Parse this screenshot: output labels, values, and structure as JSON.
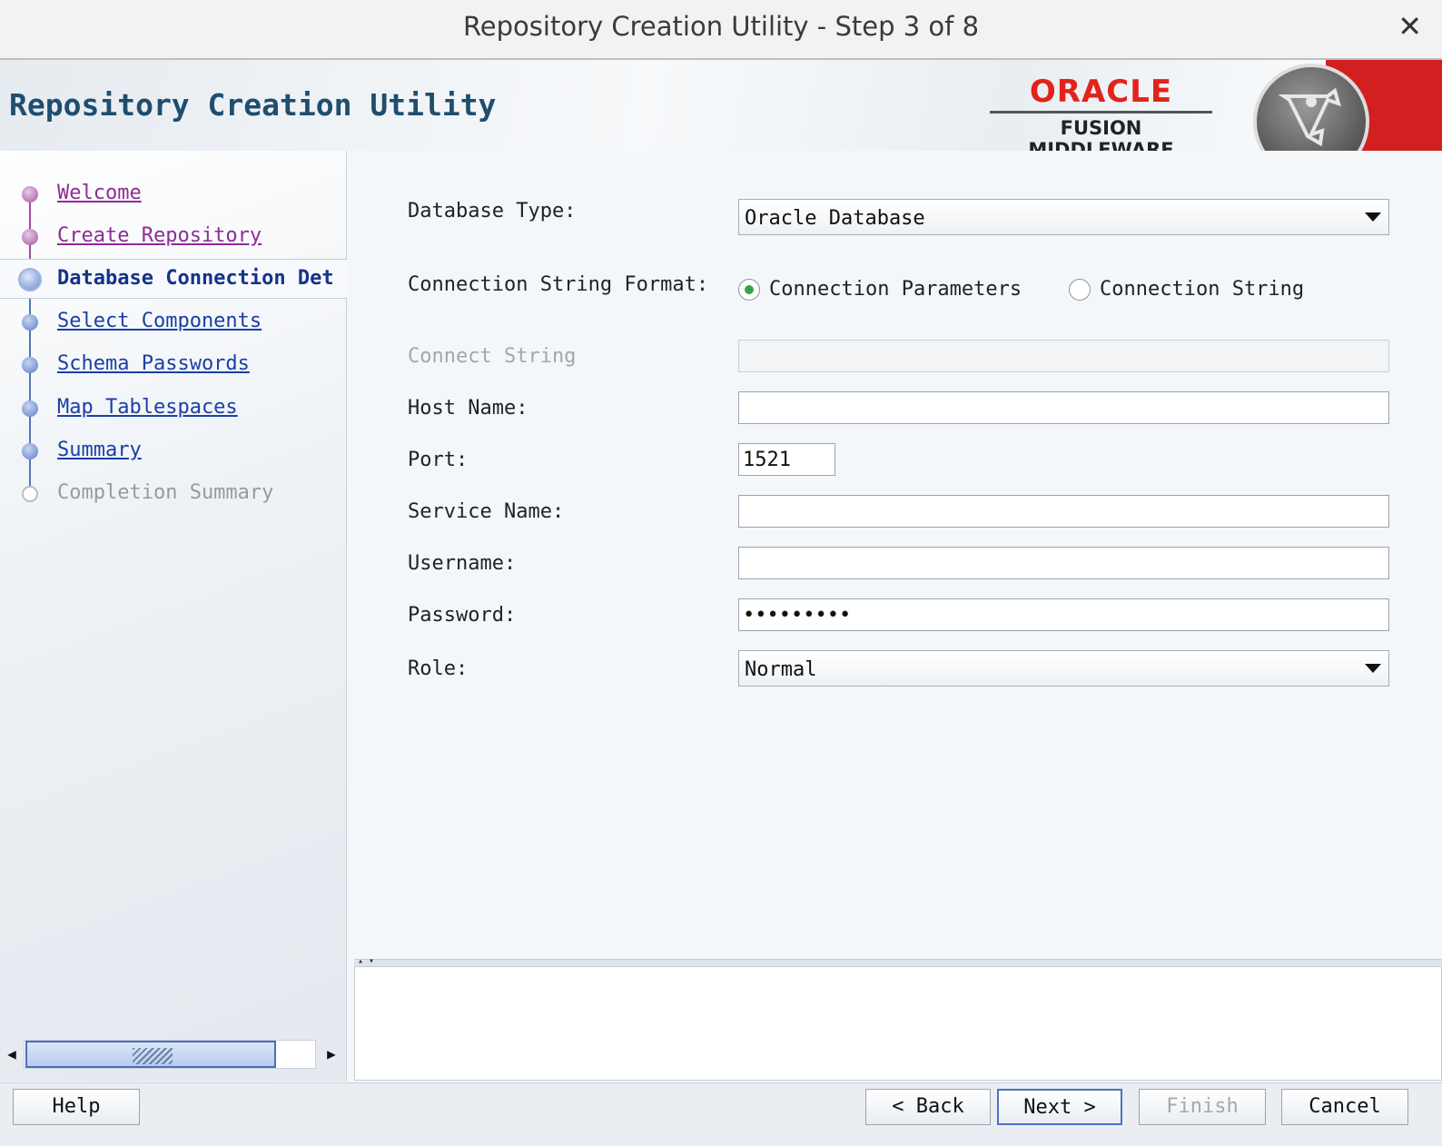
{
  "window": {
    "title": "Repository Creation Utility - Step 3 of 8",
    "close_glyph": "✕"
  },
  "header": {
    "app_title": "Repository Creation Utility",
    "brand": "ORACLE",
    "product": "FUSION MIDDLEWARE",
    "brand_color": "#e2231a"
  },
  "nav": {
    "items": [
      {
        "label": "Welcome",
        "state": "visited"
      },
      {
        "label": "Create Repository",
        "state": "visited"
      },
      {
        "label": "Database Connection Det",
        "state": "current"
      },
      {
        "label": "Select Components",
        "state": "pending"
      },
      {
        "label": "Schema Passwords",
        "state": "pending"
      },
      {
        "label": "Map Tablespaces",
        "state": "pending"
      },
      {
        "label": "Summary",
        "state": "pending"
      },
      {
        "label": "Completion Summary",
        "state": "inactive"
      }
    ]
  },
  "form": {
    "database_type": {
      "label": "Database Type:",
      "value": "Oracle Database"
    },
    "connection_format": {
      "label": "Connection String Format:",
      "options": [
        "Connection Parameters",
        "Connection String"
      ],
      "selected": "Connection Parameters"
    },
    "connect_string": {
      "label": "Connect String",
      "value": ""
    },
    "host_name": {
      "label": "Host Name:",
      "value": ""
    },
    "port": {
      "label": "Port:",
      "value": "1521"
    },
    "service_name": {
      "label": "Service Name:",
      "value": ""
    },
    "username": {
      "label": "Username:",
      "value": ""
    },
    "password": {
      "label": "Password:",
      "value": "•••••••••"
    },
    "role": {
      "label": "Role:",
      "value": "Normal"
    }
  },
  "footer": {
    "help": "Help",
    "back": "< Back",
    "next": "Next >",
    "finish": "Finish",
    "cancel": "Cancel"
  }
}
